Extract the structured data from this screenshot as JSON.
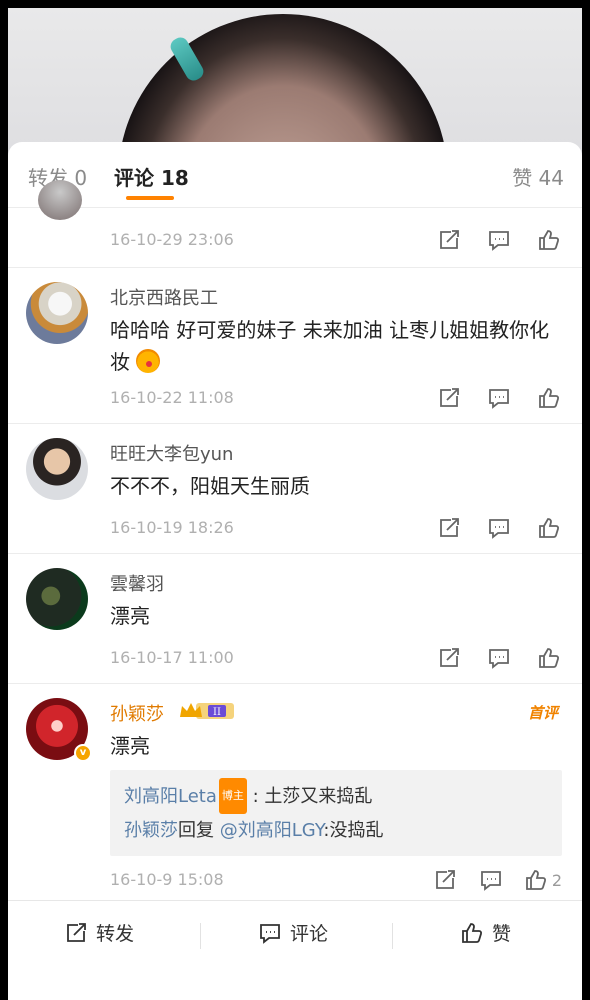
{
  "tabs": {
    "repost": "转发 0",
    "comments": "评论 18",
    "likes": "赞 44"
  },
  "partial_comment": {
    "time": "16-10-29 23:06"
  },
  "comments": [
    {
      "name": "北京西路民工",
      "text": "哈哈哈 好可爱的妹子 未来加油 让枣儿姐姐教你化妆",
      "time": "16-10-22 11:08"
    },
    {
      "name": "旺旺大李包yun",
      "text": "不不不，阳姐天生丽质",
      "time": "16-10-19 18:26"
    },
    {
      "name": "雲馨羽",
      "text": "漂亮",
      "time": "16-10-17 11:00"
    },
    {
      "name": "孙颖莎",
      "first_tag": "首评",
      "text": "漂亮",
      "time": "16-10-9 15:08",
      "like_count": "2",
      "replies": [
        {
          "author": "刘高阳Leta",
          "badge": "博主",
          "text": ": 土莎又来捣乱"
        },
        {
          "author": "孙颖莎",
          "mid": "回复",
          "mention": "@刘高阳LGY",
          "text": ":没捣乱"
        }
      ]
    }
  ],
  "bottom_bar": {
    "repost": "转发",
    "comment": "评论",
    "like": "赞"
  },
  "colors": {
    "accent": "#ff8200",
    "link": "#5a7fa8",
    "time": "#b0b0b0"
  }
}
